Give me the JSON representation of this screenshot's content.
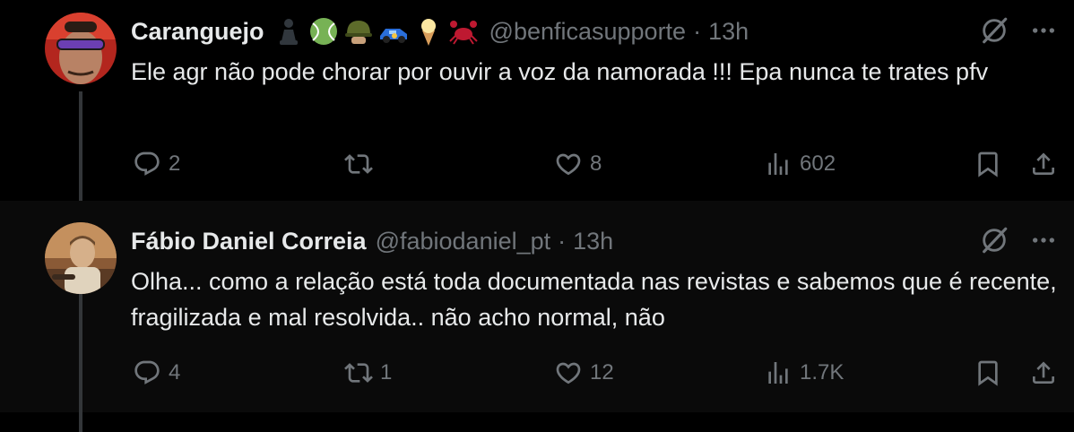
{
  "tweets": [
    {
      "name": "Caranguejo",
      "emojis": [
        "chess-pawn",
        "tennis-ball",
        "military-helmet",
        "racing-car",
        "ice-cream",
        "crab"
      ],
      "handle": "@benficasupporte",
      "separator": "·",
      "time": "13h",
      "text": "Ele agr não pode chorar por ouvir a voz da namorada !!! Epa nunca te trates pfv",
      "replies": "2",
      "reposts": "",
      "likes": "8",
      "views": "602"
    },
    {
      "name": "Fábio Daniel Correia",
      "handle": "@fabiodaniel_pt",
      "separator": "·",
      "time": "13h",
      "text": "Olha... como a relação está toda documentada nas revistas e sabemos que é recente, fragilizada e mal resolvida.. não acho normal, não",
      "replies": "4",
      "reposts": "1",
      "likes": "12",
      "views": "1.7K"
    }
  ],
  "colors": {
    "text": "#e7e9ea",
    "secondary": "#71767b",
    "thread_line": "#333639",
    "background": "#000000",
    "hover_row": "#0a0a0a"
  },
  "icons": [
    "reply-icon",
    "repost-icon",
    "like-icon",
    "views-icon",
    "bookmark-icon",
    "share-icon",
    "grok-icon",
    "more-icon"
  ]
}
